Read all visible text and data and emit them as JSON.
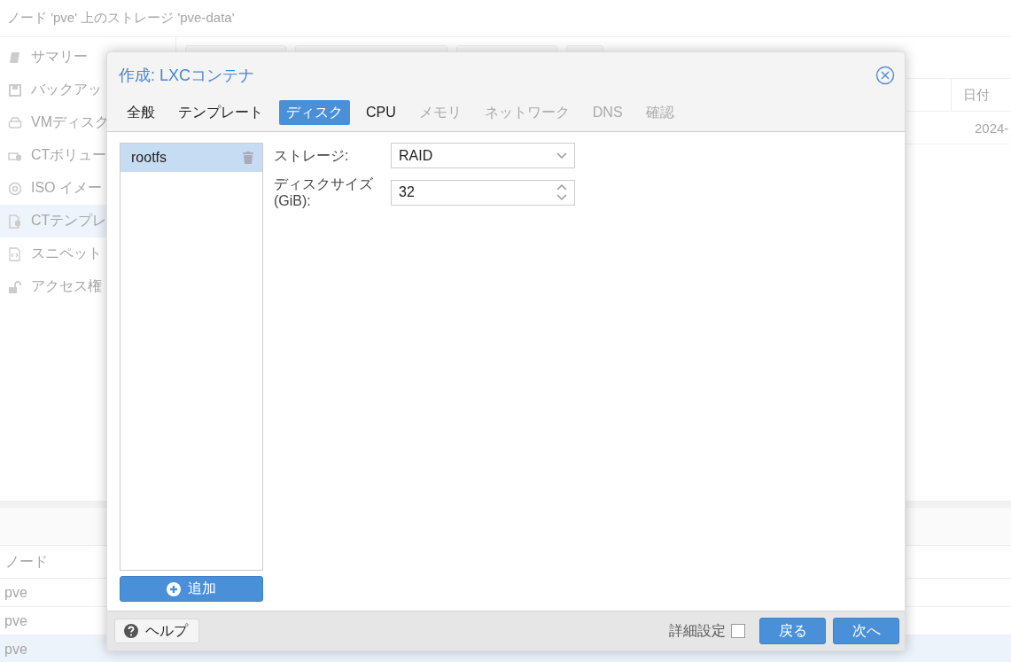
{
  "page": {
    "title": "ノード 'pve' 上のストレージ 'pve-data'"
  },
  "sidebar": {
    "items": [
      {
        "label": "サマリー",
        "selected": false
      },
      {
        "label": "バックアッ",
        "selected": false
      },
      {
        "label": "VMディスク",
        "selected": false
      },
      {
        "label": "CTボリュー",
        "selected": false
      },
      {
        "label": "ISO イメー",
        "selected": false
      },
      {
        "label": "CTテンプレ",
        "selected": true
      },
      {
        "label": "スニペット",
        "selected": false
      },
      {
        "label": "アクセス権",
        "selected": false
      }
    ]
  },
  "content_grid": {
    "columns": [
      "日付"
    ],
    "rows": [
      [
        "2024-"
      ]
    ]
  },
  "log_panel": {
    "columns": [
      "ノード"
    ],
    "rows": [
      {
        "node": "pve",
        "selected": false
      },
      {
        "node": "pve",
        "selected": false
      },
      {
        "node": "pve",
        "selected": true
      }
    ]
  },
  "dialog": {
    "title": "作成: LXCコンテナ",
    "tabs": [
      {
        "label": "全般",
        "selected": false,
        "disabled": false
      },
      {
        "label": "テンプレート",
        "selected": false,
        "disabled": false
      },
      {
        "label": "ディスク",
        "selected": true,
        "disabled": false
      },
      {
        "label": "CPU",
        "selected": false,
        "disabled": false
      },
      {
        "label": "メモリ",
        "selected": false,
        "disabled": true
      },
      {
        "label": "ネットワーク",
        "selected": false,
        "disabled": true
      },
      {
        "label": "DNS",
        "selected": false,
        "disabled": true
      },
      {
        "label": "確認",
        "selected": false,
        "disabled": true
      }
    ],
    "disks": [
      {
        "label": "rootfs",
        "selected": true
      }
    ],
    "add_button": "追加",
    "fields": [
      {
        "kind": "combo",
        "label": "ストレージ:",
        "value": "RAID"
      },
      {
        "kind": "spinner",
        "label": "ディスクサイズ",
        "sublabel": "(GiB):",
        "value": "32"
      }
    ],
    "help_button": "ヘルプ",
    "advanced": {
      "label": "詳細設定",
      "checked": false
    },
    "back_button": "戻る",
    "next_button": "次へ"
  }
}
